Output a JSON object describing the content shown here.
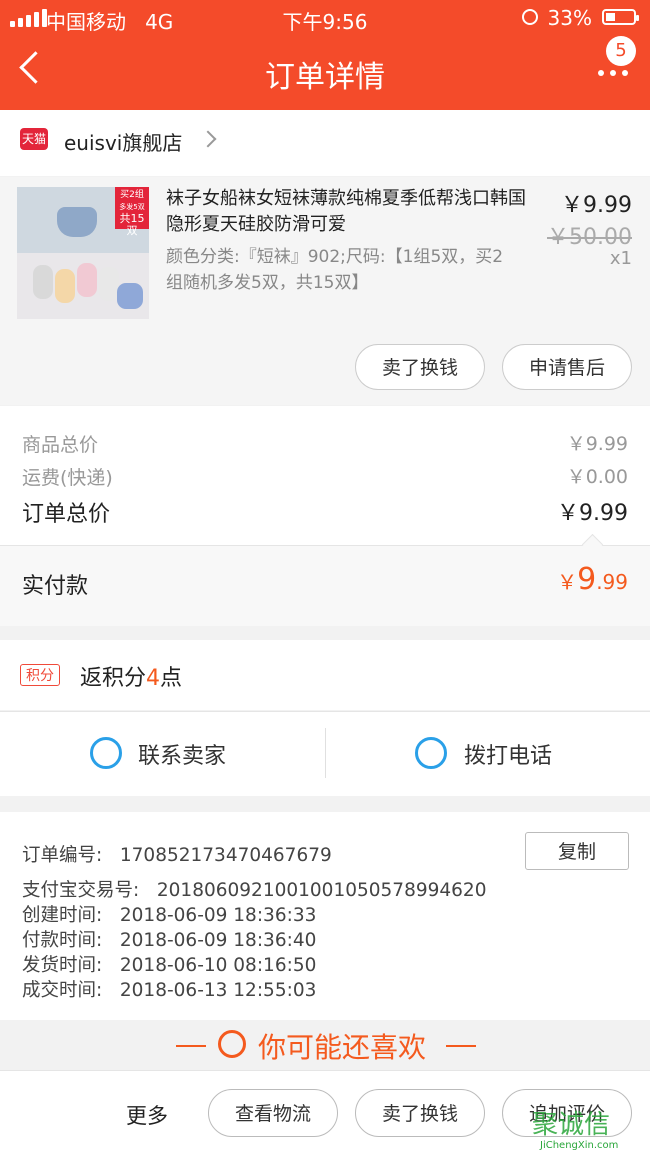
{
  "status_bar": {
    "carrier": "中国移动",
    "network": "4G",
    "time": "下午9:56",
    "battery_pct": "33%",
    "battery_level": 0.33
  },
  "header": {
    "title": "订单详情",
    "badge": "5"
  },
  "store": {
    "tag": "天猫",
    "name": "euisvi旗舰店"
  },
  "product": {
    "title": "袜子女船袜女短袜薄款纯棉夏季低帮浅口韩国隐形夏天硅胶防滑可爱",
    "spec": "颜色分类:『短袜』902;尺码:【1组5双，买2组随机多发5双，共15双】",
    "price": "￥9.99",
    "old_price": "￥50.00",
    "qty": "x1",
    "promo_line1": "买2组",
    "promo_line2": "多发5双",
    "promo_line3": "共15双",
    "actions": [
      "卖了换钱",
      "申请售后"
    ]
  },
  "summary": {
    "items_label": "商品总价",
    "items_value": "￥9.99",
    "shipping_label": "运费(快递)",
    "shipping_value": "￥0.00",
    "total_label": "订单总价",
    "total_value": "￥9.99",
    "paid_label": "实付款",
    "paid_currency": "￥",
    "paid_int": "9",
    "paid_dec": ".99"
  },
  "points": {
    "tag": "积分",
    "prefix": "返积分",
    "num": "4",
    "suffix": "点"
  },
  "contact": {
    "seller": "联系卖家",
    "phone": "拨打电话"
  },
  "order_info": {
    "order_no_label": "订单编号:",
    "order_no": "170852173470467679",
    "copy": "复制",
    "alipay_label": "支付宝交易号:",
    "alipay_no": "2018060921001001050578994620",
    "created_label": "创建时间:",
    "created": "2018-06-09 18:36:33",
    "paid_label": "付款时间:",
    "paid": "2018-06-09 18:36:40",
    "shipped_label": "发货时间:",
    "shipped": "2018-06-10 08:16:50",
    "done_label": "成交时间:",
    "done": "2018-06-13 12:55:03"
  },
  "recommend": {
    "title": "你可能还喜欢"
  },
  "bottom": {
    "more": "更多",
    "buttons": [
      "查看物流",
      "卖了换钱",
      "追加评价"
    ]
  },
  "watermark": {
    "main": "聚诚信",
    "sub": "JiChengXin.com"
  },
  "colors": {
    "accent": "#f44b2a",
    "price_orange": "#f45a1e",
    "icon_blue": "#2aa0e8"
  }
}
